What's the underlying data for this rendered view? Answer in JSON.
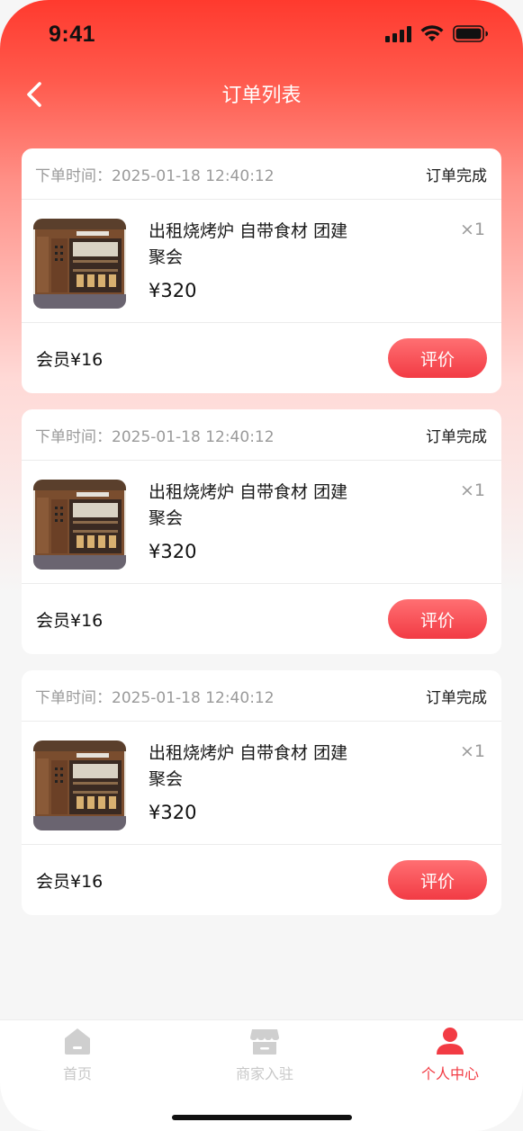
{
  "status_bar": {
    "time": "9:41"
  },
  "nav": {
    "title": "订单列表",
    "back_icon": "chevron-left-icon"
  },
  "orders": [
    {
      "time": "下单时间：2025-01-18 12:40:12",
      "status": "订单完成",
      "product_name": "出租烧烤炉 自带食材 团建聚会",
      "price": "¥320",
      "quantity": "×1",
      "member_price": "会员¥16",
      "action": "评价"
    },
    {
      "time": "下单时间：2025-01-18 12:40:12",
      "status": "订单完成",
      "product_name": "出租烧烤炉 自带食材 团建聚会",
      "price": "¥320",
      "quantity": "×1",
      "member_price": "会员¥16",
      "action": "评价"
    },
    {
      "time": "下单时间：2025-01-18 12:40:12",
      "status": "订单完成",
      "product_name": "出租烧烤炉 自带食材 团建聚会",
      "price": "¥320",
      "quantity": "×1",
      "member_price": "会员¥16",
      "action": "评价"
    }
  ],
  "tab_bar": {
    "items": [
      {
        "label": "首页",
        "icon": "home-icon",
        "active": false
      },
      {
        "label": "商家入驻",
        "icon": "store-icon",
        "active": false
      },
      {
        "label": "个人中心",
        "icon": "user-icon",
        "active": true
      }
    ],
    "active_color": "#f23b44",
    "inactive_color": "#c8c8c8"
  },
  "colors": {
    "accent": "#f23b44",
    "header_gradient_top": "#ff3a2e"
  }
}
